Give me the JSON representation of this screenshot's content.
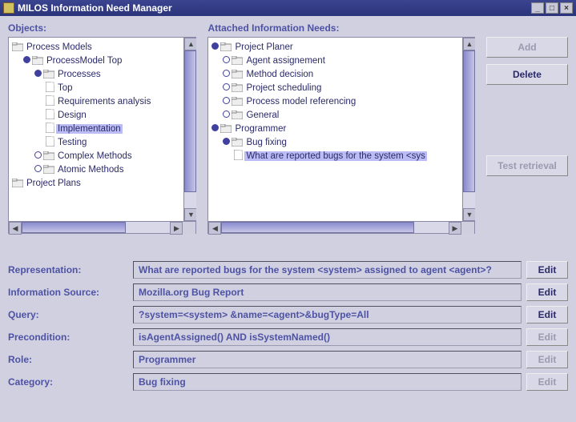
{
  "window": {
    "title": "MILOS Information Need Manager",
    "min_label": "_",
    "max_label": "□",
    "close_label": "×"
  },
  "panels": {
    "objects_label": "Objects:",
    "needs_label": "Attached Information Needs:"
  },
  "objects_tree": {
    "root": "Process Models",
    "top_model": "ProcessModel Top",
    "processes": "Processes",
    "top": "Top",
    "req": "Requirements analysis",
    "design": "Design",
    "impl": "Implementation",
    "testing": "Testing",
    "complex": "Complex Methods",
    "atomic": "Atomic Methods",
    "plans": "Project Plans"
  },
  "needs_tree": {
    "planer": "Project Planer",
    "agent": "Agent assignement",
    "method": "Method decision",
    "sched": "Project scheduling",
    "refmodel": "Process model referencing",
    "general": "General",
    "programmer": "Programmer",
    "bugfix": "Bug fixing",
    "question": "What are reported bugs for the system <sys"
  },
  "buttons": {
    "add": "Add",
    "delete": "Delete",
    "test_retrieval": "Test retrieval"
  },
  "form": {
    "representation_label": "Representation:",
    "representation_value": "What are reported bugs for the system <system> assigned to agent <agent>?",
    "source_label": "Information Source:",
    "source_value": "Mozilla.org Bug Report",
    "query_label": "Query:",
    "query_value": "?system=<system> &name=<agent>&bugType=All",
    "precond_label": "Precondition:",
    "precond_value": "isAgentAssigned() AND isSystemNamed()",
    "role_label": "Role:",
    "role_value": "Programmer",
    "category_label": "Category:",
    "category_value": "Bug fixing",
    "edit_label": "Edit"
  }
}
